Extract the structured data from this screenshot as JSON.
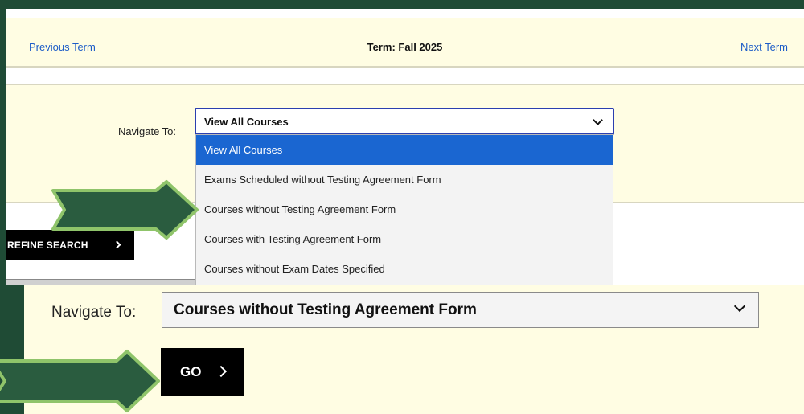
{
  "term_bar": {
    "previous_label": "Previous Term",
    "term_label": "Term: Fall 2025",
    "next_label": "Next Term"
  },
  "navigate": {
    "label": "Navigate To:",
    "selected": "View All Courses",
    "options": [
      "View All Courses",
      "Exams Scheduled without Testing Agreement Form",
      "Courses without Testing Agreement Form",
      "Courses with Testing Agreement Form",
      "Courses without Exam Dates Specified"
    ]
  },
  "refine": {
    "label": "REFINE SEARCH"
  },
  "navigate_result": {
    "label": "Navigate To:",
    "selected": "Courses without Testing Agreement Form"
  },
  "go": {
    "label": "GO"
  },
  "colors": {
    "background": "#1f4b35",
    "panel": "#fffde3",
    "highlight": "#1a66d1",
    "arrow_fill": "#2a5c3f",
    "arrow_outline": "#8fc46a"
  }
}
